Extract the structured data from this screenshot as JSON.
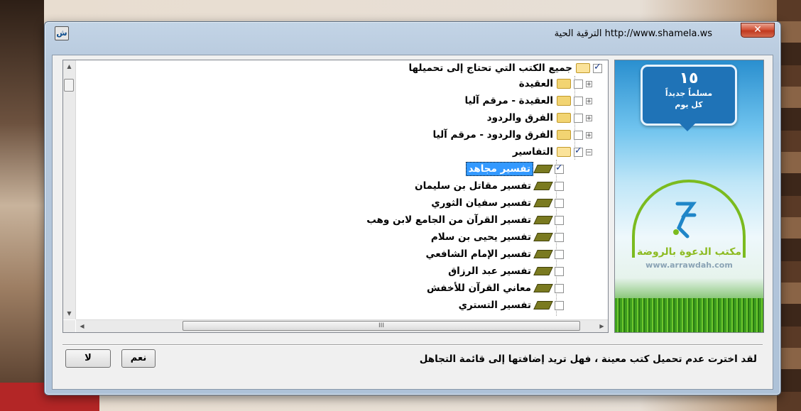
{
  "window": {
    "title": "http://www.shamela.ws   الترقية الحية",
    "close_label": "✕",
    "app_icon_text": "ش"
  },
  "tree": {
    "root": {
      "label": "جميع الكتب التي تحتاج إلى تحميلها",
      "checked": true
    },
    "groups": [
      {
        "label": "العقيدة",
        "checked": false,
        "expander": "+"
      },
      {
        "label": "العقيدة - مرقم آليا",
        "checked": false,
        "expander": "+"
      },
      {
        "label": "الفرق والردود",
        "checked": false,
        "expander": "+"
      },
      {
        "label": "الفرق والردود - مرقم آليا",
        "checked": false,
        "expander": "+"
      },
      {
        "label": "التفاسير",
        "checked": true,
        "expander": "−"
      }
    ],
    "books": [
      {
        "label": "تفسير مجاهد",
        "checked": true,
        "selected": true
      },
      {
        "label": "تفسير مقاتل بن سليمان",
        "checked": false
      },
      {
        "label": "تفسير سفيان الثوري",
        "checked": false
      },
      {
        "label": "تفسير القرآن من الجامع لابن وهب",
        "checked": false
      },
      {
        "label": "تفسير يحيى بن سلام",
        "checked": false
      },
      {
        "label": "تفسير الإمام الشافعي",
        "checked": false
      },
      {
        "label": "تفسير عبد الرزاق",
        "checked": false
      },
      {
        "label": "معاني القرآن للأخفش",
        "checked": false
      },
      {
        "label": "تفسير التستري",
        "checked": false
      }
    ]
  },
  "scrollbar": {
    "thumb_grip": "III"
  },
  "banner": {
    "number": "١٥",
    "line1": "مسلماً جديداً",
    "line2": "كل يوم",
    "org_name": "مكتب الدعوة بالروضة",
    "org_url": "www.arrawdah.com"
  },
  "prompt": {
    "message": "لقد اخترت عدم تحميل كتب معينة ، فهل تريد إضافتها إلى قائمة التجاهل",
    "yes_label": "نعم",
    "no_label": "لا"
  },
  "colors": {
    "selection": "#3399ff",
    "close": "#c0391f",
    "banner_blue": "#1f73b7",
    "banner_green": "#7bbb1f"
  }
}
